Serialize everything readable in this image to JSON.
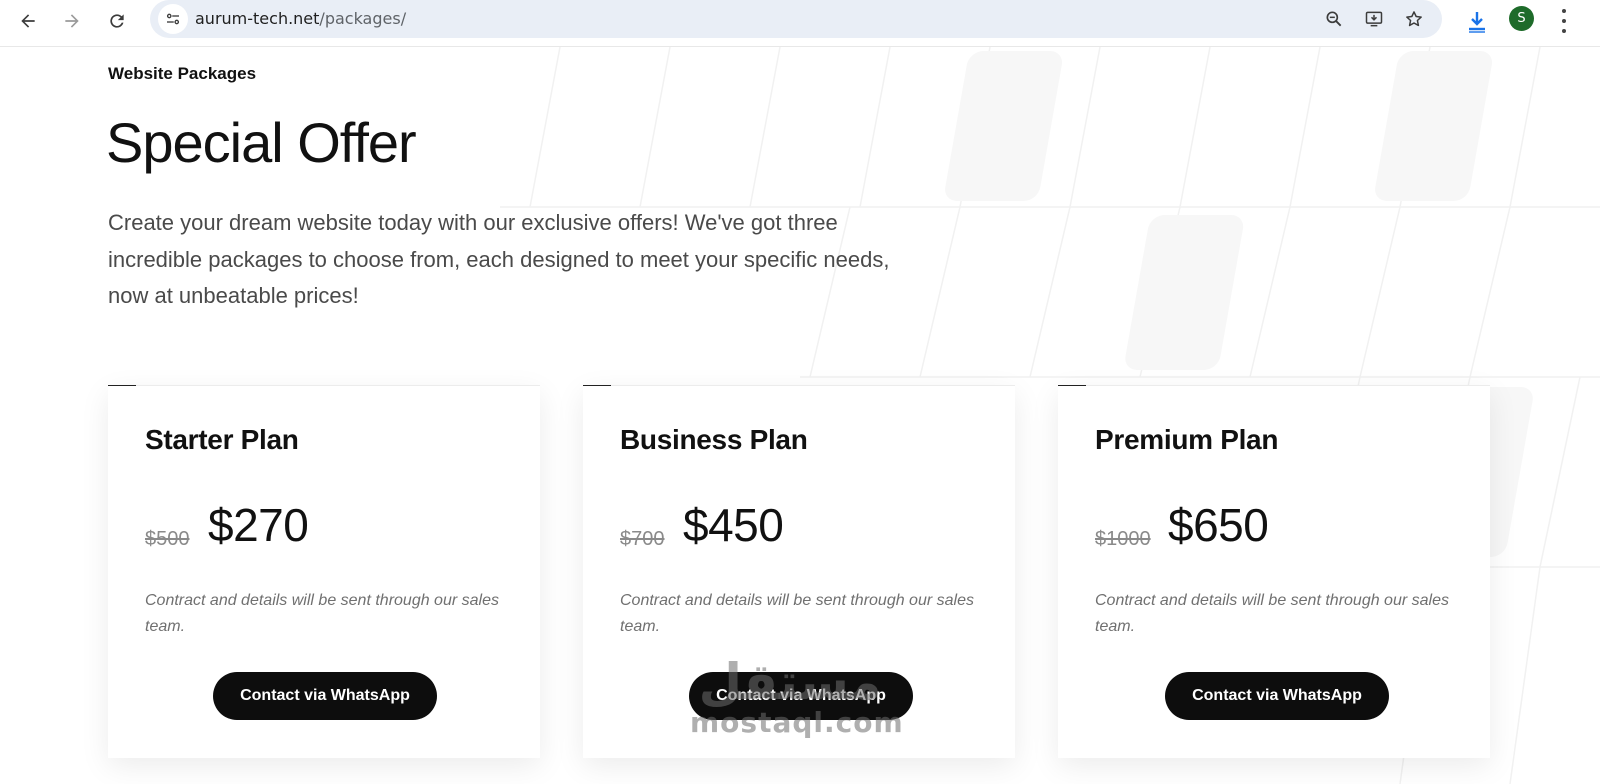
{
  "browser": {
    "url_host": "aurum-tech.net",
    "url_path": "/packages/",
    "avatar_initial": "S",
    "icons": [
      "back-icon",
      "forward-icon",
      "reload-icon",
      "site-info-icon",
      "zoom-icon",
      "install-app-icon",
      "bookmark-star-icon",
      "download-icon",
      "menu-dots-icon"
    ]
  },
  "hero": {
    "eyebrow": "Website Packages",
    "title": "Special Offer",
    "intro_lines": [
      "Create your dream website today with our exclusive offers! We've got three",
      "incredible packages to choose from, each designed to meet your specific needs,",
      "now at unbeatable prices!"
    ]
  },
  "plans": [
    {
      "name": "Starter Plan",
      "old_price": "$500",
      "price": "$270",
      "note": "Contract and details will be sent through our sales team.",
      "cta": "Contact via WhatsApp"
    },
    {
      "name": "Business Plan",
      "old_price": "$700",
      "price": "$450",
      "note": "Contract and details will be sent through our sales team.",
      "cta": "Contact via WhatsApp"
    },
    {
      "name": "Premium Plan",
      "old_price": "$1000",
      "price": "$650",
      "note": "Contract and details will be sent through our sales team.",
      "cta": "Contact via WhatsApp"
    }
  ],
  "watermark": {
    "arabic": "مستقل",
    "latin": "mostaql.com"
  }
}
